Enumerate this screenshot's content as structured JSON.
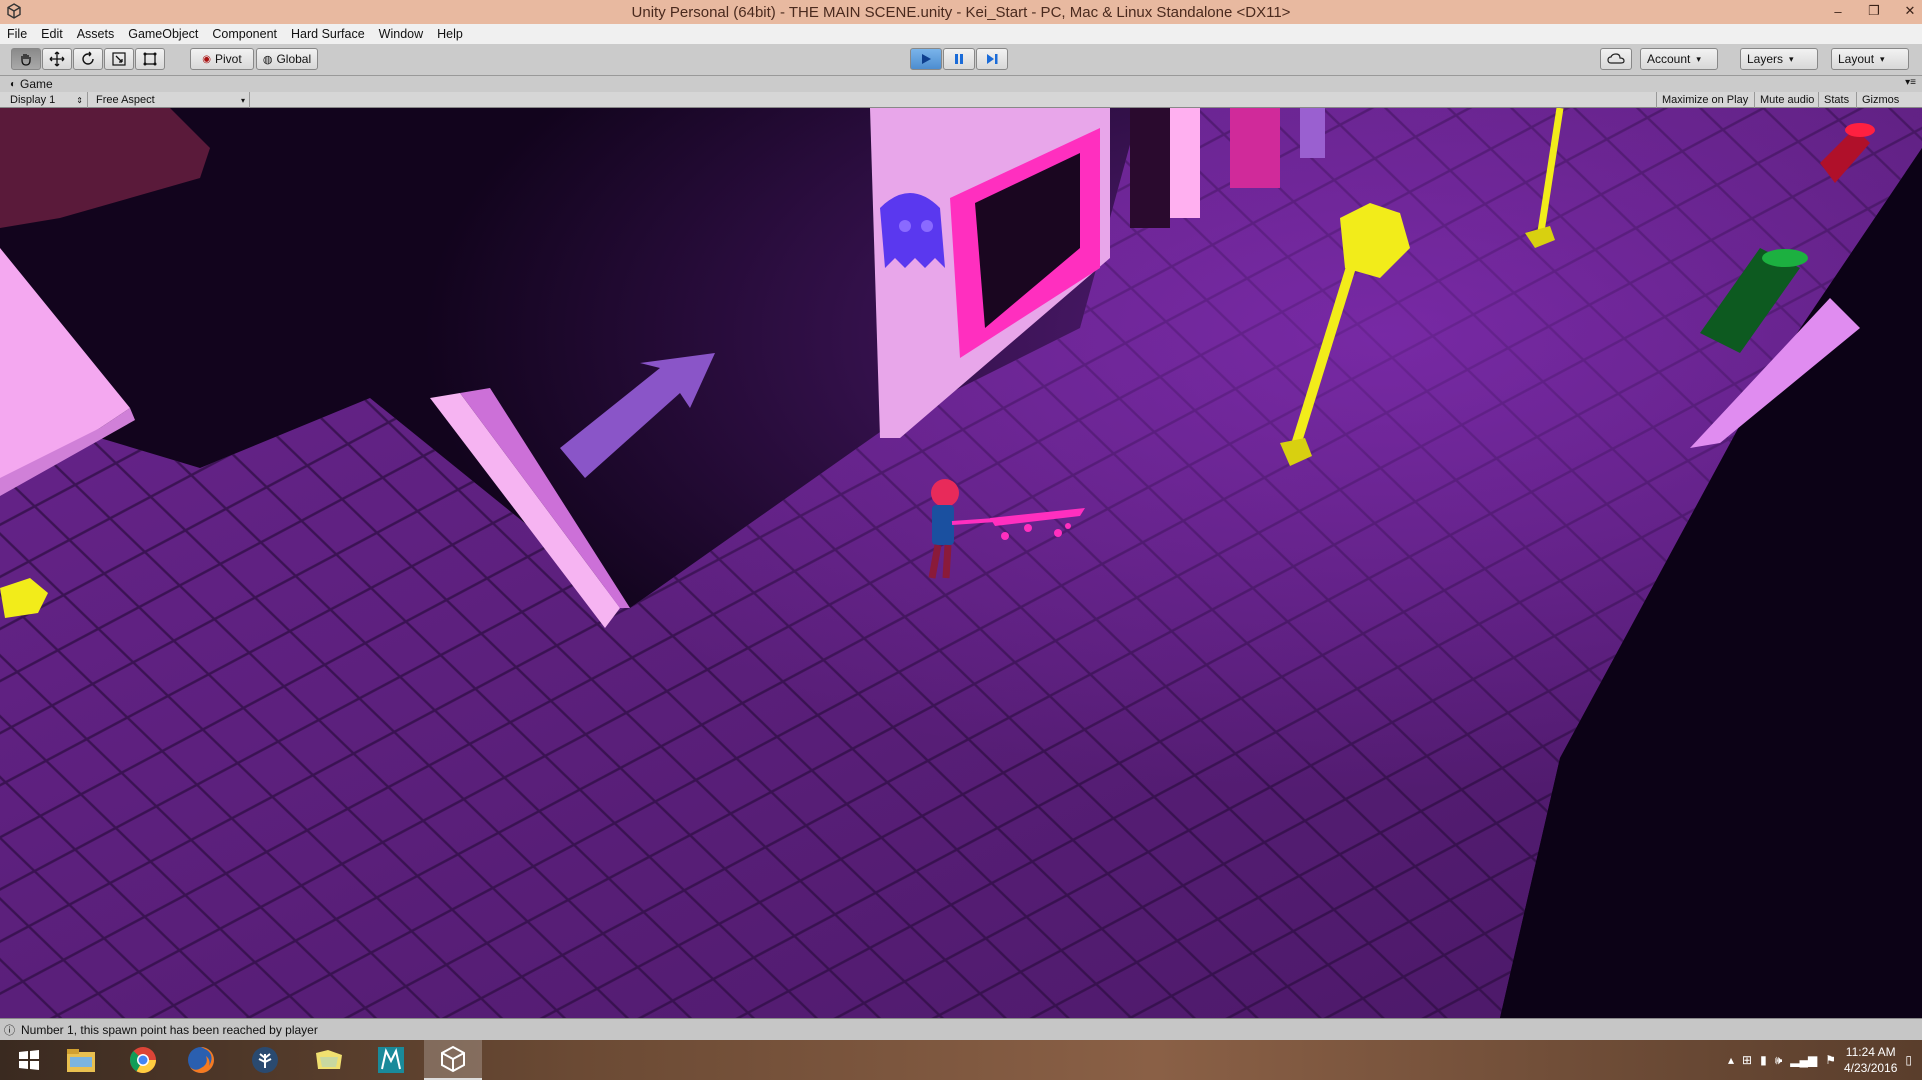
{
  "titlebar": {
    "title": "Unity Personal (64bit) - THE MAIN SCENE.unity - Kei_Start - PC, Mac & Linux Standalone <DX11>",
    "minimize": "–",
    "restore": "❐",
    "close": "✕"
  },
  "menu": [
    "File",
    "Edit",
    "Assets",
    "GameObject",
    "Component",
    "Hard Surface",
    "Window",
    "Help"
  ],
  "toolbar": {
    "pivot": "Pivot",
    "global": "Global",
    "account": "Account",
    "layers": "Layers",
    "layout": "Layout"
  },
  "game": {
    "tab_label": "Game",
    "display": "Display 1",
    "aspect": "Free Aspect",
    "maximize_on_play": "Maximize on Play",
    "mute_audio": "Mute audio",
    "stats": "Stats",
    "gizmos": "Gizmos"
  },
  "status": {
    "message": "Number 1, this spawn point has been reached by player"
  },
  "taskbar": {
    "time": "11:24 AM",
    "date": "4/23/2016",
    "apps": [
      "start-icon",
      "file-explorer-icon",
      "chrome-icon",
      "firefox-icon",
      "tree-app-icon",
      "folder-app-icon",
      "maya-icon",
      "unity-icon"
    ]
  },
  "colors": {
    "floor": "#5a1f7a",
    "wall": "#0e0318",
    "neon_pink": "#ff2fbf",
    "lamp_yellow": "#f2ec1a",
    "arrow_purple": "#8a55c8"
  }
}
